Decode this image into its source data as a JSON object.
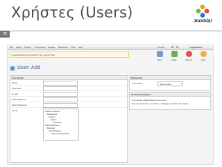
{
  "slide": {
    "title": "Χρήστες (Users)",
    "page_number": "72",
    "logo_text": "Joomla!"
  },
  "app": {
    "menu": [
      "Site",
      "Menus",
      "Content",
      "Components",
      "Modules",
      "Extensions",
      "Tools",
      "Help"
    ],
    "status": {
      "preview": "Preview",
      "logout": "Logout admin"
    },
    "notice": "kompromised info ps Joomla! T com_users T view"
  },
  "toolbar": {
    "buttons": [
      {
        "label": "Save",
        "color": "#7a9cc6"
      },
      {
        "label": "Apply",
        "color": "#6ab04c"
      },
      {
        "label": "Cancel",
        "color": "#d9534f"
      },
      {
        "label": "Help",
        "color": "#f0ad4e"
      }
    ]
  },
  "page": {
    "title": "User: Add"
  },
  "user_details": {
    "header": "User Details",
    "fields": [
      "Name",
      "Username",
      "E-mail",
      "New Password",
      "Verify Password",
      "Group"
    ],
    "groups": [
      {
        "label": "Public Frontend",
        "level": 0
      },
      {
        "label": "- Registered",
        "level": 1
      },
      {
        "label": "- Author",
        "level": 2
      },
      {
        "label": "- Editor",
        "level": 3
      },
      {
        "label": "- Publisher",
        "level": 4
      },
      {
        "label": "Public Backend",
        "level": 0
      },
      {
        "label": "- Manager",
        "level": 1
      },
      {
        "label": "- Administrator",
        "level": 2
      },
      {
        "label": "- Super Administrator",
        "level": 3
      }
    ]
  },
  "parameters": {
    "header": "Parameters",
    "user_editor_label": "User Editor",
    "user_editor_value": "Select Editor"
  },
  "contact_information": {
    "header": "Contact Information",
    "line1": "No Contact details linked to this User:",
    "line2": "See 'Components -> Contact -> Manage Contacts' for details."
  }
}
